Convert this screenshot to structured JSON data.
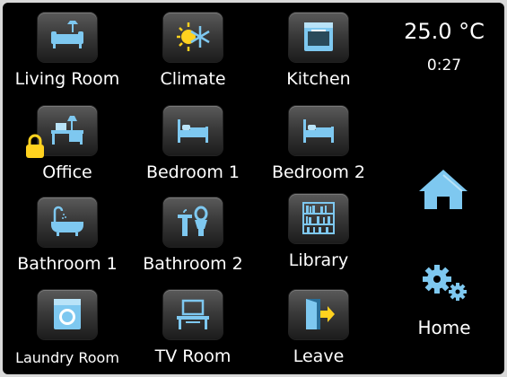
{
  "tiles": [
    {
      "label": "Living Room",
      "icon": "sofa-icon"
    },
    {
      "label": "Climate",
      "icon": "climate-icon"
    },
    {
      "label": "Kitchen",
      "icon": "oven-icon"
    },
    {
      "label": "Office",
      "icon": "desk-icon"
    },
    {
      "label": "Bedroom 1",
      "icon": "bed-icon"
    },
    {
      "label": "Bedroom 2",
      "icon": "bed-icon"
    },
    {
      "label": "Bathroom 1",
      "icon": "bathtub-icon"
    },
    {
      "label": "Bathroom 2",
      "icon": "toilet-icon"
    },
    {
      "label": "Library",
      "icon": "bookshelf-icon"
    },
    {
      "label": "Laundry Room",
      "icon": "washing-machine-icon"
    },
    {
      "label": "TV Room",
      "icon": "tv-icon"
    },
    {
      "label": "Leave",
      "icon": "exit-door-icon"
    }
  ],
  "status": {
    "temperature": "25.0 °C",
    "time": "0:27"
  },
  "nav": {
    "home_label": "Home"
  },
  "colors": {
    "icon": "#7ec8f0",
    "accent": "#ffd21f",
    "background": "#000000",
    "text": "#ffffff"
  }
}
